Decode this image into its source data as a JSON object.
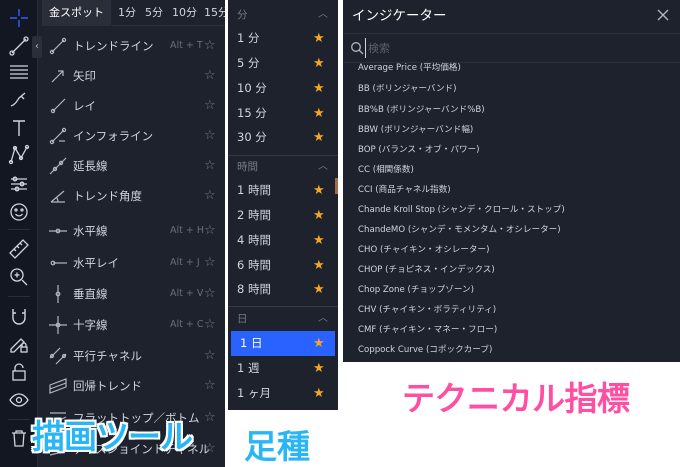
{
  "drawing_tools": {
    "tabs": [
      "金スポット",
      "1分",
      "5分",
      "10分",
      "15分"
    ],
    "toolbar_icons": [
      "crosshair-icon",
      "trend-line-icon",
      "fib-icon",
      "brush-icon",
      "text-icon",
      "pattern-icon",
      "prediction-icon",
      "emoji-icon",
      "ruler-icon",
      "zoom-in-icon",
      "magnet-icon",
      "lock-drawing-icon",
      "lock-icon",
      "eye-icon",
      "trash-icon"
    ],
    "tools": [
      {
        "label": "トレンドライン",
        "shortcut": "Alt + T",
        "icon": "trend-line-icon"
      },
      {
        "label": "矢印",
        "shortcut": "",
        "icon": "arrow-icon"
      },
      {
        "label": "レイ",
        "shortcut": "",
        "icon": "ray-icon"
      },
      {
        "label": "インフォライン",
        "shortcut": "",
        "icon": "info-line-icon"
      },
      {
        "label": "延長線",
        "shortcut": "",
        "icon": "extended-line-icon"
      },
      {
        "label": "トレンド角度",
        "shortcut": "",
        "icon": "trend-angle-icon"
      },
      {
        "label": "水平線",
        "shortcut": "Alt + H",
        "icon": "horizontal-line-icon"
      },
      {
        "label": "水平レイ",
        "shortcut": "Alt + J",
        "icon": "horizontal-ray-icon"
      },
      {
        "label": "垂直線",
        "shortcut": "Alt + V",
        "icon": "vertical-line-icon"
      },
      {
        "label": "十字線",
        "shortcut": "Alt + C",
        "icon": "cross-line-icon"
      },
      {
        "label": "平行チャネル",
        "shortcut": "",
        "icon": "parallel-channel-icon"
      },
      {
        "label": "回帰トレンド",
        "shortcut": "",
        "icon": "regression-trend-icon"
      },
      {
        "label": "フラットトップ／ボトム",
        "shortcut": "",
        "icon": "flat-top-bottom-icon"
      },
      {
        "label": "ディスジョイントチャネル",
        "shortcut": "",
        "icon": "disjoint-channel-icon"
      }
    ],
    "caption": "描画ツール"
  },
  "timeframes": {
    "sections": [
      {
        "header": "分",
        "items": [
          "1 分",
          "5 分",
          "10 分",
          "15 分",
          "30 分"
        ]
      },
      {
        "header": "時間",
        "items": [
          "1 時間",
          "2 時間",
          "4 時間",
          "6 時間",
          "8 時間"
        ]
      },
      {
        "header": "日",
        "items": [
          "1 日",
          "1 週",
          "1 ヶ月"
        ]
      }
    ],
    "selected": "1 日",
    "caption": "足種"
  },
  "indicators": {
    "title": "インジケーター",
    "search_placeholder": "検索",
    "items": [
      "Average Price (平均価格)",
      "BB (ボリンジャーバンド)",
      "BB%B (ボリンジャーバンド%B)",
      "BBW (ボリンジャーバンド幅)",
      "BOP (バランス・オブ・パワー)",
      "CC (相関係数)",
      "CCI (商品チャネル指数)",
      "Chande Kroll Stop (シャンデ・クロール・ストップ)",
      "ChandeMO (シャンデ・モメンタム・オシレーター)",
      "CHO (チャイキン・オシレーター)",
      "CHOP (チョピネス・インデックス)",
      "Chop Zone (チョップゾーン)",
      "CHV (チャイキン・ボラティリティ)",
      "CMF (チャイキン・マネー・フロー)",
      "Coppock Curve (コポックカーブ)"
    ],
    "caption": "テクニカル指標"
  },
  "colors": {
    "panel_bg": "#1e222d",
    "selected_bg": "#2962ff",
    "favorite_star": "#f5a623",
    "caption_blue": "#29b6f6",
    "caption_pink": "#ff4fa3"
  }
}
